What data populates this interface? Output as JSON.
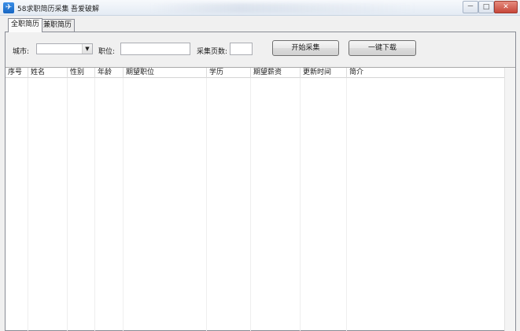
{
  "window": {
    "title": "58求职简历采集",
    "subtitle": "吾爱破解",
    "icon": "app-icon",
    "controls": {
      "minimize": "－",
      "maximize": "□",
      "close": "✕"
    }
  },
  "tabs": [
    {
      "label": "全职简历",
      "selected": true
    },
    {
      "label": "兼职简历",
      "selected": false
    }
  ],
  "form": {
    "city_label": "城市:",
    "city_value": "",
    "position_label": "职位:",
    "position_value": "",
    "pages_label": "采集页数:",
    "pages_value": "",
    "start_button": "开始采集",
    "download_button": "一键下载",
    "dropdown_arrow": "▼"
  },
  "table": {
    "columns": [
      "序号",
      "姓名",
      "性别",
      "年龄",
      "期望职位",
      "学历",
      "期望薪资",
      "更新时间",
      "简介"
    ],
    "rows": []
  },
  "colors": {
    "titlebar_top": "#f7f9fc",
    "titlebar_bottom": "#e4ebf4",
    "window_bg": "#f0f0f0",
    "close_button": "#c7473a"
  }
}
